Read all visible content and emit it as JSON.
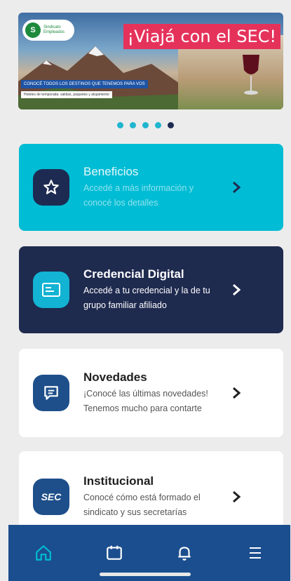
{
  "banner": {
    "headline": "¡Viajá con el SEC!",
    "strip_text": "CONOCÉ TODOS LOS DESTINOS QUE TENEMOS PARA VOS",
    "strip_subtext": "Hoteles de temporada: salidas, paquetes y alojamiento",
    "logo_text": "Sindicato Empleados",
    "slide_count": 5,
    "active_slide": 5
  },
  "cards": [
    {
      "title": "Beneficios",
      "description": "Accedé a más información y conocé los detalles",
      "icon": "star-icon"
    },
    {
      "title": "Credencial Digital",
      "description": "Accedé a tu credencial y la de tu grupo familiar afiliado",
      "icon": "card-icon"
    },
    {
      "title": "Novedades",
      "description": "¡Conocé las últimas novedades! Tenemos mucho para contarte",
      "icon": "chat-icon"
    },
    {
      "title": "Institucional",
      "description": "Conocé cómo está formado el sindicato y sus secretarías",
      "icon": "sec-logo-icon",
      "icon_text": "SEC"
    }
  ],
  "bottom_nav": {
    "items": [
      "home-icon",
      "calendar-icon",
      "bell-icon",
      "menu-icon"
    ],
    "active": "home-icon"
  },
  "colors": {
    "background": "#ececec",
    "cyan": "#00bcd4",
    "navy": "#1f2a4f",
    "nav_blue": "#1b4e8e",
    "banner_pink": "#e5325b"
  }
}
